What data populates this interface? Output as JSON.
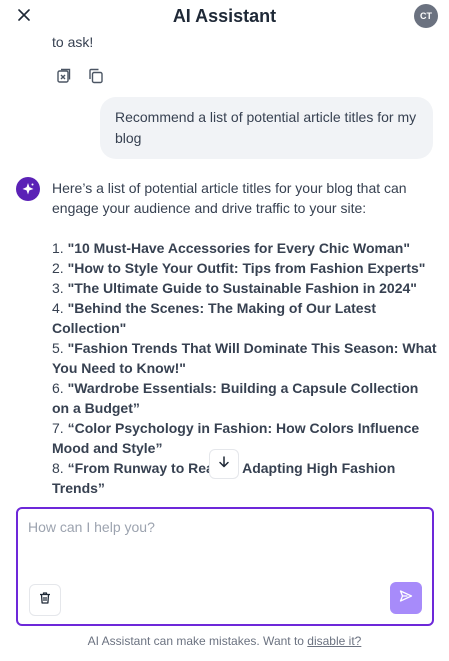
{
  "header": {
    "title": "AI Assistant",
    "avatar_initials": "CT"
  },
  "previous_message": {
    "tail_text": "to ask!"
  },
  "user_message": {
    "text": "Recommend a list of potential article titles for my blog"
  },
  "ai_message": {
    "intro": "Here’s a list of potential article titles for your blog that can engage your audience and drive traffic to your site:",
    "items": [
      {
        "num": "1.",
        "title": "\"10 Must-Have Accessories for Every Chic Woman\""
      },
      {
        "num": "2.",
        "title": "\"How to Style Your Outfit: Tips from Fashion Experts\""
      },
      {
        "num": "3.",
        "title": "\"The Ultimate Guide to Sustainable Fashion in 2024\""
      },
      {
        "num": "4.",
        "title": "\"Behind the Scenes: The Making of Our Latest Collection\""
      },
      {
        "num": "5.",
        "title": "\"Fashion Trends That Will Dominate This Season: What You Need to Know!\""
      },
      {
        "num": "6.",
        "title": "\"Wardrobe Essentials: Building a Capsule Collection on a Budget”"
      },
      {
        "num": "7.",
        "title": "“Color Psychology in Fashion: How Colors Influence Mood and Style”"
      },
      {
        "num": "8.",
        "title": "“From Runway to Reality: Adapting High Fashion Trends”"
      }
    ]
  },
  "composer": {
    "placeholder": "How can I help you?"
  },
  "footer": {
    "text": "AI Assistant can make mistakes. Want to ",
    "link": "disable it?"
  },
  "colors": {
    "accent": "#6d28d9",
    "send_button": "#a78bfa",
    "user_bubble": "#f1f3f6"
  },
  "icons": [
    "close-icon",
    "avatar",
    "copy-regenerate-icon",
    "copy-icon",
    "ai-sparkle-icon",
    "arrow-down-icon",
    "trash-icon",
    "send-icon"
  ]
}
